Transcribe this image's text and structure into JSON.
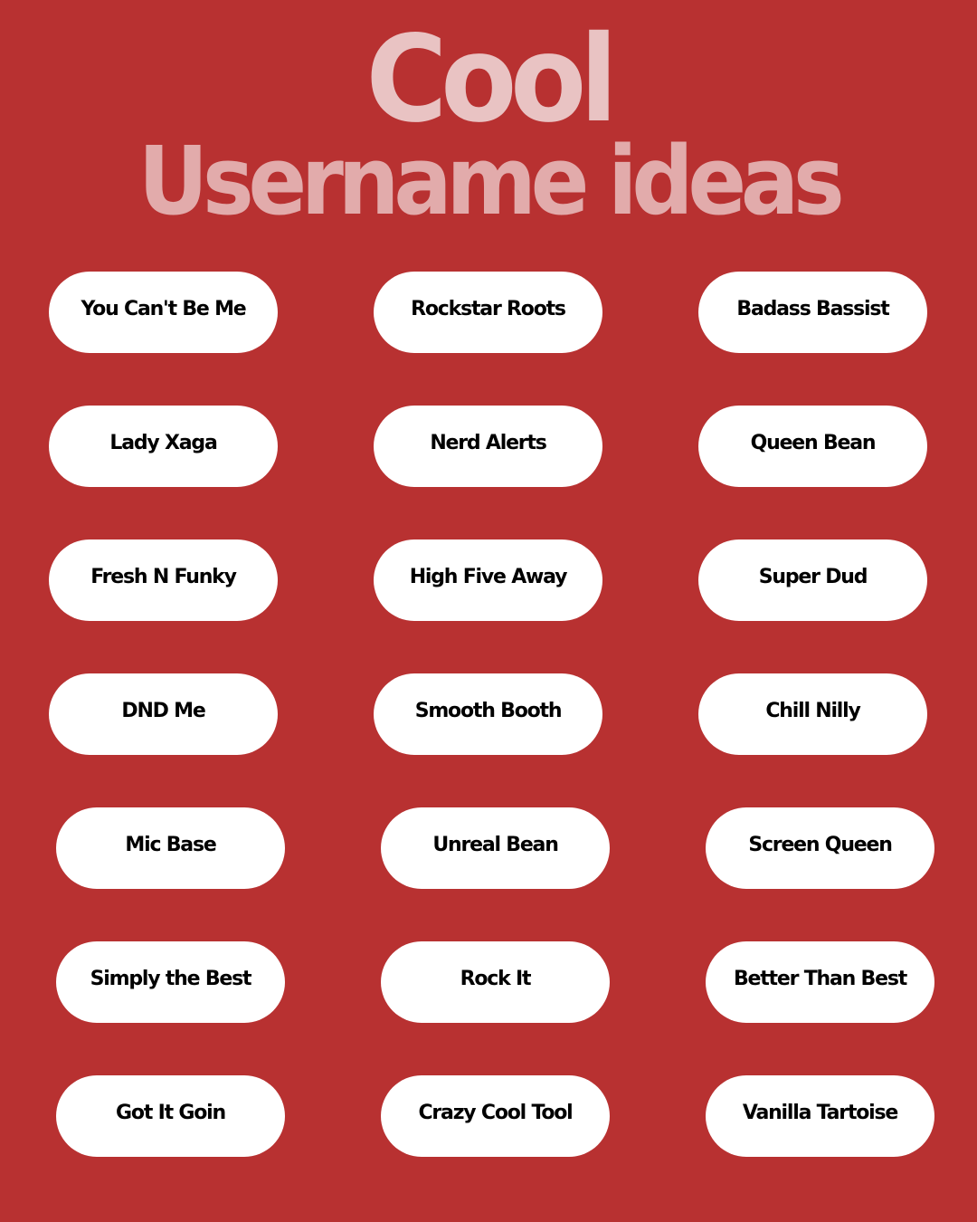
{
  "title": {
    "line1": "Cool",
    "line2": "Username ideas"
  },
  "colors": {
    "background": "#b83131",
    "title_line1": "#e9c3c3",
    "title_line2": "#e2abab",
    "pill_background": "#ffffff",
    "pill_text": "#000000"
  },
  "usernames": [
    [
      "You Can't Be Me",
      "Rockstar Roots",
      "Badass Bassist"
    ],
    [
      "Lady Xaga",
      "Nerd Alerts",
      "Queen Bean"
    ],
    [
      "Fresh N Funky",
      "High Five Away",
      "Super Dud"
    ],
    [
      "DND Me",
      "Smooth Booth",
      "Chill Nilly"
    ],
    [
      "Mic Base",
      "Unreal Bean",
      "Screen Queen"
    ],
    [
      "Simply the Best",
      "Rock It",
      "Better Than Best"
    ],
    [
      "Got It Goin",
      "Crazy Cool Tool",
      "Vanilla Tartoise"
    ]
  ]
}
